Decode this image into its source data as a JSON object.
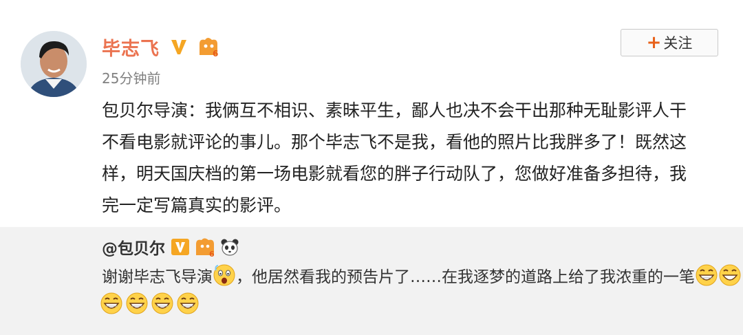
{
  "post": {
    "author_name": "毕志飞",
    "verified_icon": "v-verified-icon",
    "vip_icon": "vip-level-icon",
    "timestamp": "25分钟前",
    "follow_button": {
      "plus": "+",
      "label": "关注"
    },
    "text_lines": [
      "包贝尔导演：我俩互不相识、素昧平生，鄙人也决不会干出那种无耻影评人干",
      "不看电影就评论的事儿。那个毕志飞不是我，看他的照片比我胖多了！既然这",
      "样，明天国庆档的第一场电影就看您的胖子行动队了，您做好准备多担待，我",
      "完一定写篇真实的影评。"
    ]
  },
  "repost": {
    "author": "@包贝尔",
    "icons": [
      "v-verified-icon",
      "vip-level-icon",
      "panda-icon"
    ],
    "text_before_emoji": "谢谢毕志飞导演",
    "text_after_emoji": "，他居然看我的预告片了……在我逐梦的道路上给了我浓重的一笔",
    "emojis": [
      "scared-face-emoji",
      "grin-emoji",
      "grin-emoji",
      "grin-emoji",
      "grin-emoji",
      "grin-emoji",
      "grin-emoji"
    ]
  },
  "colors": {
    "author_name": "#eb7350",
    "verified_badge": "#f5a623",
    "follow_plus": "#e8611a",
    "repost_background": "#f2f2f2"
  }
}
